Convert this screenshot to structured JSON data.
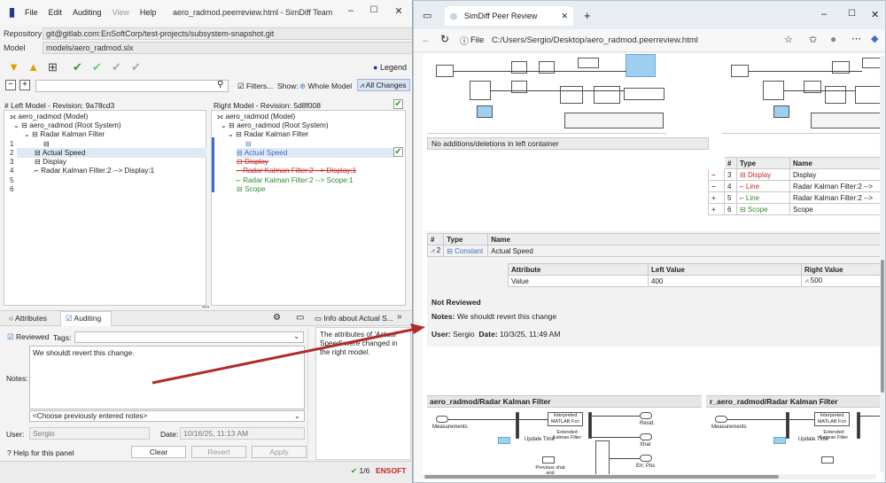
{
  "simdiff": {
    "menu": [
      "File",
      "Edit",
      "Auditing",
      "View",
      "Help"
    ],
    "title": "aero_radmod.peerreview.html - SimDiff Team",
    "repo_label": "Repository",
    "repo_value": "git@gitlab.com:EnSoftCorp/test-projects/subsystem-snapshot.git",
    "model_label": "Model",
    "model_value": "models/aero_radmod.slx",
    "legend": "Legend",
    "filters_label": "Filters...",
    "show_label": "Show:",
    "whole_model": "Whole Model",
    "all_changes": "All Changes",
    "left_header": "# Left Model - Revision: 9a78cd3",
    "right_header": "Right Model - Revision: 5d8f008",
    "left_tree": {
      "model": "aero_radmod (Model)",
      "root": "aero_radmod (Root System)",
      "filter": "Radar Kalman Filter",
      "actual": "Actual Speed",
      "display": "Display",
      "line": "Radar Kalman Filter:2 --> Display:1"
    },
    "right_tree": {
      "model": "aero_radmod (Model)",
      "root": "aero_radmod (Root System)",
      "filter": "Radar Kalman Filter",
      "actual": "Actual Speed",
      "display": "Display",
      "line1": "Radar Kalman Filter:2 --> Display:1",
      "line2": "Radar Kalman Filter:2 --> Scope:1",
      "scope": "Scope"
    },
    "line_numbers": [
      "1",
      "2",
      "3",
      "4",
      "5",
      "6"
    ],
    "tabs": {
      "attributes": "Attributes",
      "auditing": "Auditing",
      "info": "Info about Actual S..."
    },
    "reviewed_label": "Reviewed",
    "tags_label": "Tags:",
    "notes_text": "We shouldt revert this change.",
    "notes_label": "Notes:",
    "notes_dropdown": "<Choose previously entered notes>",
    "user_label": "User:",
    "user_value": "Sergio",
    "date_label": "Date:",
    "date_value": "10/16/25, 11:13 AM",
    "help_label": "Help for this panel",
    "buttons": {
      "clear": "Clear",
      "revert": "Revert",
      "apply": "Apply"
    },
    "info_text": "The attributes of 'Actual Speed' were changed in the right model.",
    "status_count": "1/6",
    "brand": "ENSOFT",
    "icons": [
      "document-icon",
      "folder-icon",
      "copy-icon",
      "check-icon",
      "check-icon",
      "check-icon",
      "check-icon",
      "info-icon",
      "search-icon"
    ]
  },
  "browser": {
    "tab_title": "SimDiff Peer Review",
    "file_label": "File",
    "address": "C:/Users/Sergio/Desktop/aero_radmod.peerreview.html",
    "no_changes": "No additions/deletions in left container",
    "changes_table": {
      "headers": [
        "#",
        "Type",
        "Name"
      ],
      "rows": [
        {
          "sign": "−",
          "num": "3",
          "type": "Display",
          "name": "Display",
          "color": "#c62828"
        },
        {
          "sign": "−",
          "num": "4",
          "type": "Line",
          "name": "Radar Kalman Filter:2 -->",
          "color": "#c62828"
        },
        {
          "sign": "+",
          "num": "5",
          "type": "Line",
          "name": "Radar Kalman Filter:2 -->",
          "color": "#2e8b2e"
        },
        {
          "sign": "+",
          "num": "6",
          "type": "Scope",
          "name": "Scope",
          "color": "#2e8b2e"
        }
      ]
    },
    "modified_table": {
      "headers": [
        "#",
        "Type",
        "Name"
      ],
      "row": {
        "num": "2",
        "type": "Constant",
        "name": "Actual Speed"
      }
    },
    "attr_table": {
      "headers": [
        "Attribute",
        "Left Value",
        "Right Value"
      ],
      "row": {
        "attr": "Value",
        "left": "400",
        "right": "500"
      }
    },
    "review": {
      "status": "Not Reviewed",
      "notes_label": "Notes:",
      "notes": "We shouldt revert this change",
      "user_label": "User:",
      "user": "Sergio",
      "date_label": "Date:",
      "date": "10/3/25, 11:49 AM"
    },
    "left_diagram_title": "aero_radmod/Radar Kalman Filter",
    "right_diagram_title": "r_aero_radmod/Radar Kalman Filter",
    "diagram_labels": {
      "measurements": "Measurements",
      "interpreted": "Interpreted MATLAB Fcn",
      "extended": "Extended Kalman Filter",
      "update_time": "Update Time",
      "resid": "Resid.",
      "xhat": "Xhat",
      "err_pos": "Err. Pos",
      "previous": "Previous xhat and"
    }
  }
}
